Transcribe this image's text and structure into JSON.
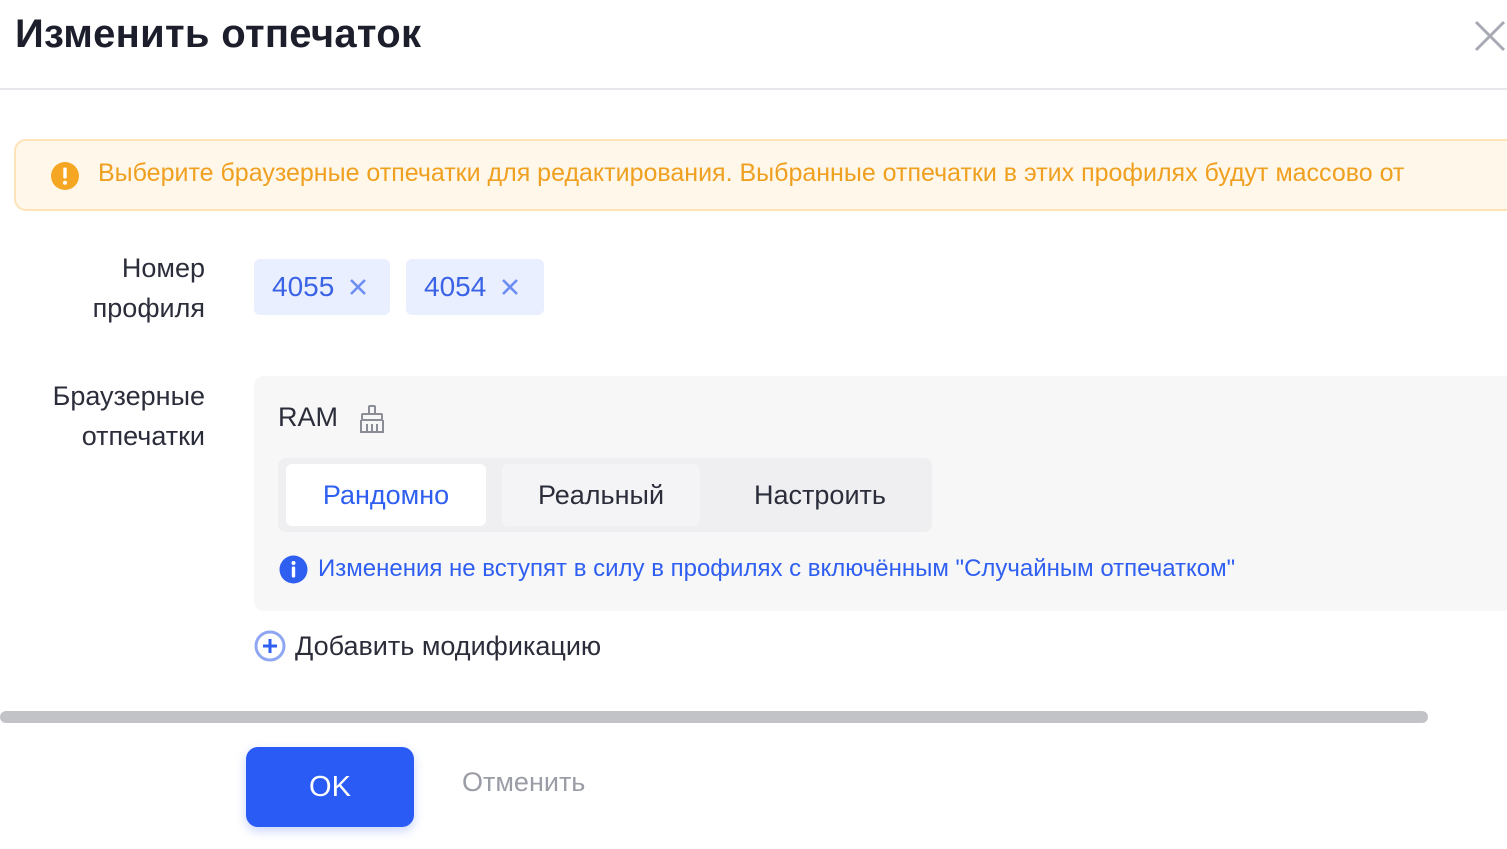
{
  "dialog": {
    "title": "Изменить отпечаток",
    "close_icon": "close-icon"
  },
  "alert": {
    "icon": "warning-icon",
    "text": "Выберите браузерные отпечатки для редактирования. Выбранные отпечатки в этих профилях будут массово от",
    "color": "#f0a020"
  },
  "profile": {
    "label": "Номер профиля",
    "tags": [
      {
        "value": "4055"
      },
      {
        "value": "4054"
      }
    ]
  },
  "fingerprints": {
    "label": "Браузерные отпечатки",
    "item": {
      "name": "RAM",
      "icon": "broom-icon",
      "options": [
        "Рандомно",
        "Реальный",
        "Настроить"
      ],
      "selected": "Рандомно",
      "info_text": "Изменения не вступят в силу в профилях с включённым \"Случайным отпечатком\""
    },
    "add_modification": "Добавить модификацию"
  },
  "footer": {
    "ok_label": "OK",
    "cancel_label": "Отменить"
  },
  "colors": {
    "accent": "#2a5cf5",
    "tag_bg": "#e9efff",
    "alert_bg": "#fff7ea"
  }
}
